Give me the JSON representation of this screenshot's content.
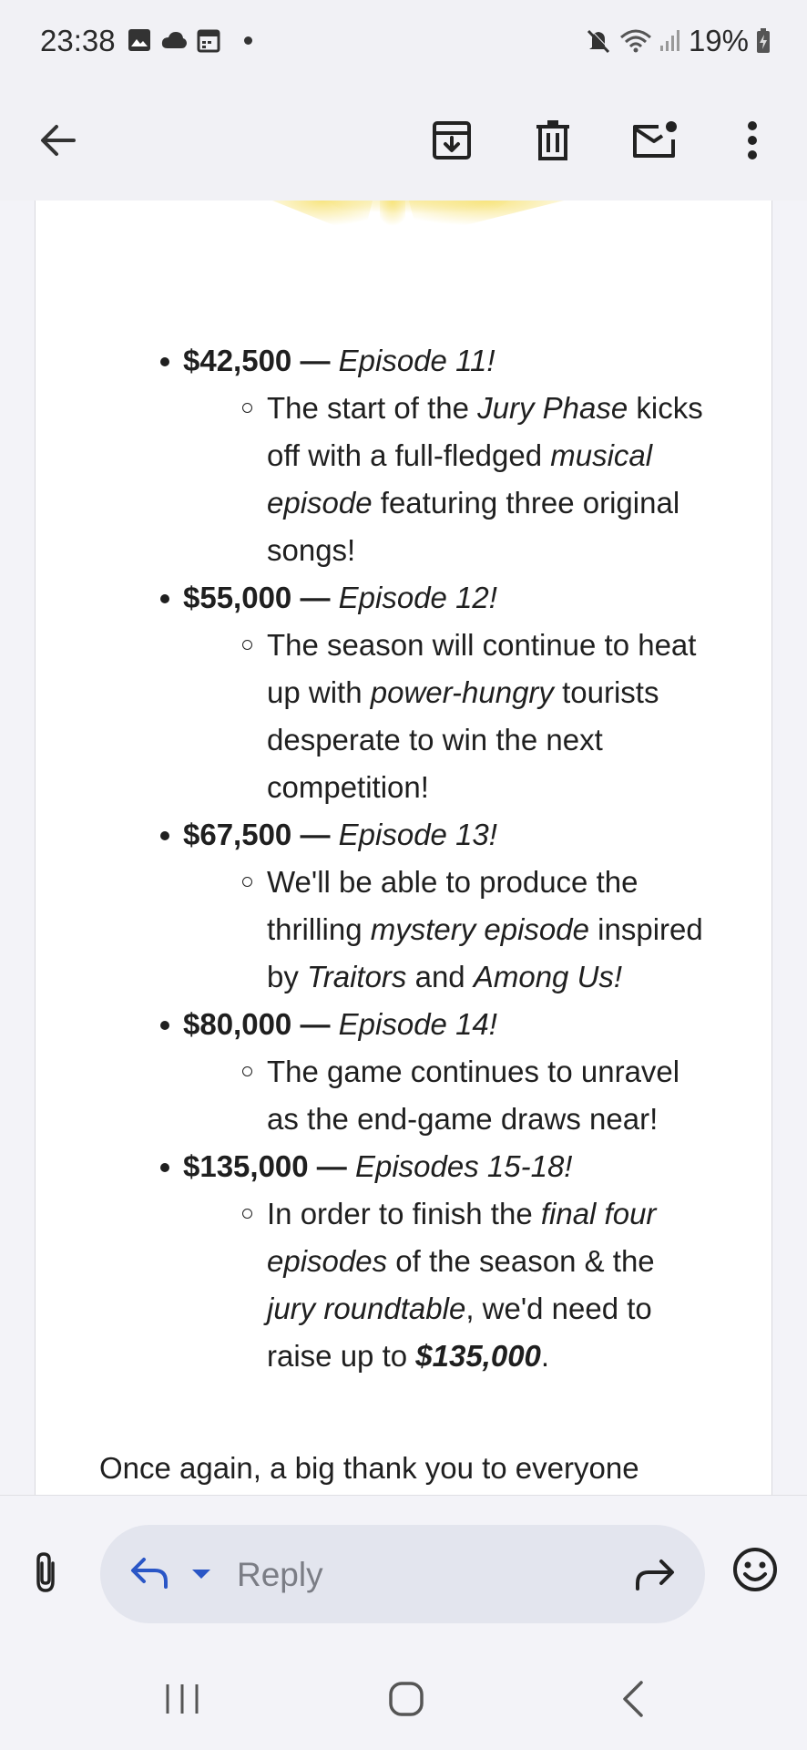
{
  "status_bar": {
    "time": "23:38",
    "battery": "19%"
  },
  "toolbar": {
    "back_icon": "arrow-back-icon",
    "archive_icon": "archive-icon",
    "delete_icon": "trash-icon",
    "unread_icon": "mark-unread-icon",
    "more_icon": "more-vert-icon"
  },
  "email": {
    "items": [
      {
        "amount": "$42,500",
        "dash": " — ",
        "episode": "Episode 11!",
        "detail": {
          "p1": "The start of the ",
          "i1": "Jury Phase",
          "p2": " kicks off with a full-fledged ",
          "i2": "musical episode",
          "p3": " featuring three original songs!"
        }
      },
      {
        "amount": "$55,000",
        "dash": " — ",
        "episode": "Episode 12!",
        "detail": {
          "p1": "The season will continue to heat up with ",
          "i1": "power-hungry",
          "p2": " tourists desperate to win the next competition!"
        }
      },
      {
        "amount": "$67,500",
        "dash": " — ",
        "episode": "Episode 13!",
        "detail": {
          "p1": "We'll be able to produce the thrilling ",
          "i1": "mystery episode",
          "p2": " inspired by ",
          "i2": "Traitors",
          "p3": " and ",
          "i3": "Among Us!"
        }
      },
      {
        "amount": "$80,000",
        "dash": " — ",
        "episode": "Episode 14!",
        "detail": {
          "p1": "The game continues to unravel as the end-game draws near!"
        }
      },
      {
        "amount": "$135,000",
        "dash": "  — ",
        "episode": "Episodes 15-18!",
        "detail": {
          "p1": "In order to finish the ",
          "i1": "final four episodes",
          "p2": " of the season & the ",
          "i2": "jury roundtable",
          "p3": ", we'd need to raise up to ",
          "bi1": "$135,000",
          "p4": "."
        }
      }
    ],
    "closing_line": "Once again, a big thank you to everyone"
  },
  "reply_bar": {
    "reply_placeholder": "Reply"
  },
  "colors": {
    "background": "#f3f3f8",
    "content": "#ffffff",
    "reply_pill": "#e3e5ee",
    "sun_yellow": "#f7e37a"
  }
}
